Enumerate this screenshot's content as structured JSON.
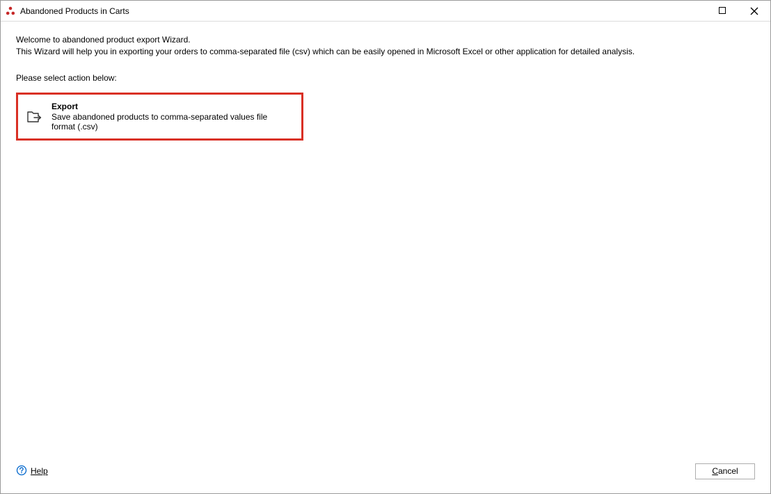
{
  "titlebar": {
    "title": "Abandoned Products in Carts"
  },
  "content": {
    "intro_line1": "Welcome to abandoned product export Wizard.",
    "intro_line2": "This Wizard will help you in exporting your orders to comma-separated file (csv) which can be easily opened in Microsoft Excel or other application for detailed analysis.",
    "select_action_label": "Please select action below:",
    "export_action": {
      "title": "Export",
      "description": "Save abandoned products to comma-separated values file format (.csv)"
    }
  },
  "footer": {
    "help_label": "Help",
    "cancel_label": "Cancel"
  }
}
